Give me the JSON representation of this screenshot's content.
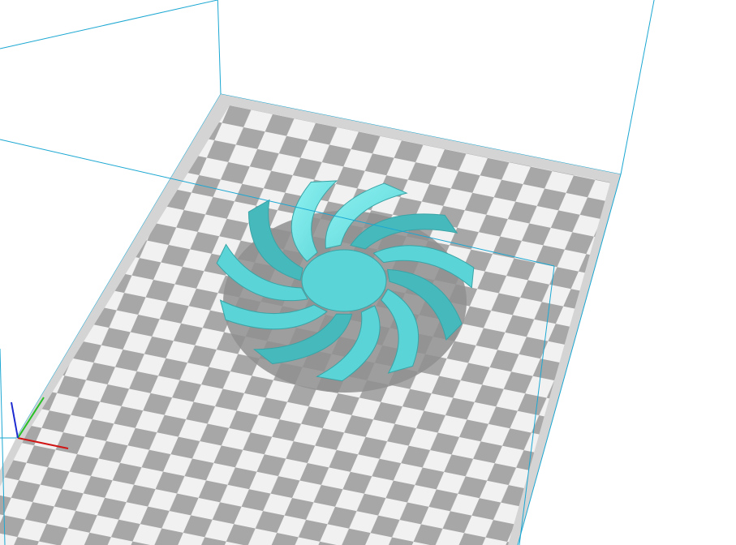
{
  "viewport": {
    "scene_name": "3d-build-volume",
    "colors": {
      "background": "#ffffff",
      "bed_dark": "#a7a7a7",
      "bed_light": "#f1f1f1",
      "bed_border": "#d4d4d4",
      "volume_edge": "#1ba7d2",
      "model": "#5ad4d6",
      "model_dark": "#46b9bc",
      "model_light": "#8ff2f2",
      "model_edge": "#3aa3a6",
      "shadow": "#8f8f8f",
      "axis_x": "#d11414",
      "axis_y": "#27c127",
      "axis_z": "#1d2bd1"
    },
    "model": {
      "name": "fan-impeller",
      "blade_count": 11
    },
    "axes": [
      "x-axis",
      "y-axis",
      "z-axis"
    ]
  }
}
